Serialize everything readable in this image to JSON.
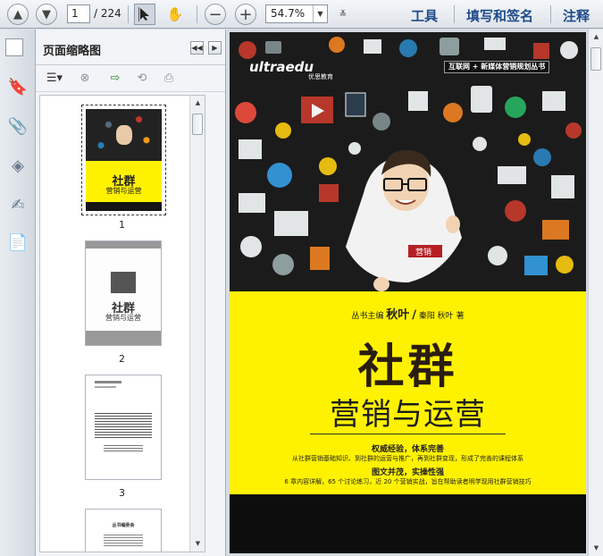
{
  "toolbar": {
    "page_current": "1",
    "page_total": "/ 224",
    "zoom_value": "54.7%",
    "tools_label": "工具",
    "sign_label": "填写和签名",
    "comment_label": "注释"
  },
  "panel": {
    "title": "页面缩略图",
    "thumbnails": [
      {
        "number": "1"
      },
      {
        "number": "2"
      },
      {
        "number": "3"
      }
    ]
  },
  "cover": {
    "logo_text": "ultraedu",
    "logo_sub": "优思教育",
    "series_label": "互联网 + 新媒体营销规划丛书",
    "badge_text": "营销",
    "editor_label": "丛书主编",
    "editor_name": "秋叶",
    "slash": "/",
    "authors_names": "秦阳 秋叶",
    "authors_suffix": "著",
    "title_main": "社群",
    "title_sub": "营销与运营",
    "feature1_title": "权威经验，体系完善",
    "feature1_desc": "从社群营销基础知识、到社群的运营与推广，再到社群变现，形成了完善的课程体系",
    "feature2_title": "图文并茂，实操性强",
    "feature2_desc": "6 章内容详解，65 个讨论练习，近 20 个营销实战，旨在帮助读者明学现用社群营销技巧"
  },
  "thumb2": {
    "title": "社群",
    "subtitle": "营销与运营"
  },
  "thumb4": {
    "title": "丛书编委会"
  },
  "colors": {
    "cover_yellow": "#fff200",
    "toolbar_link": "#1e4b8a"
  }
}
